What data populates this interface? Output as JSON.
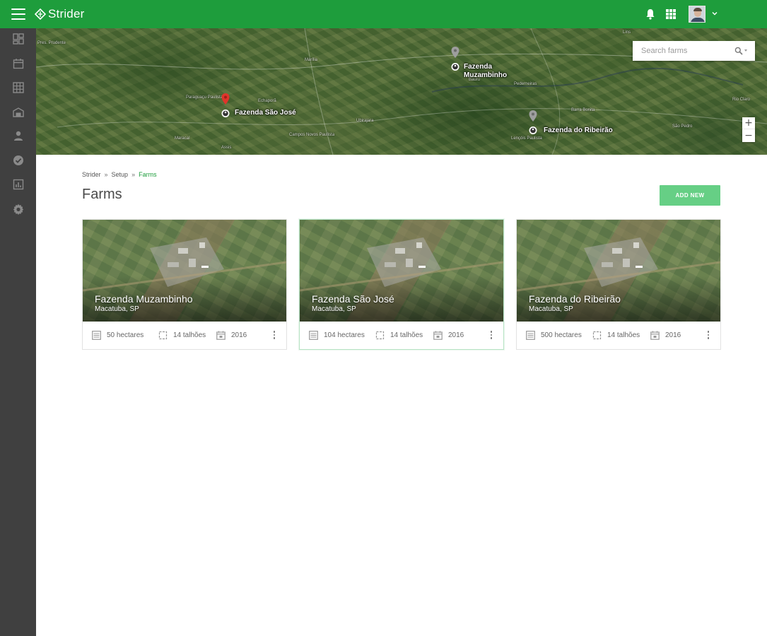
{
  "app": {
    "name": "Strider"
  },
  "header": {
    "icons": [
      "menu-icon",
      "notifications-icon",
      "apps-icon",
      "user-avatar",
      "chevron-down-icon"
    ]
  },
  "sidebar": {
    "items": [
      {
        "icon": "dashboard-icon"
      },
      {
        "icon": "calendar-icon"
      },
      {
        "icon": "grid-icon"
      },
      {
        "icon": "warehouse-icon"
      },
      {
        "icon": "person-icon"
      },
      {
        "icon": "check-circle-icon"
      },
      {
        "icon": "reports-icon"
      },
      {
        "icon": "settings-icon"
      }
    ]
  },
  "map": {
    "search_placeholder": "Search farms",
    "zoom_in": "+",
    "zoom_out": "−",
    "pins": [
      {
        "label": "Fazenda Muzambinho",
        "color": "#9e9e9e",
        "active": false
      },
      {
        "label": "Fazenda São José",
        "color": "#e0352b",
        "active": true
      },
      {
        "label": "Fazenda do Ribeirão",
        "color": "#9e9e9e",
        "active": false
      }
    ],
    "towns": [
      "Pres. Prudente",
      "Marília",
      "Bauru",
      "Lins",
      "Rio Claro",
      "Assis",
      "Lençóis Paulista",
      "Campos Novos Paulista",
      "Echaporã",
      "Ubirajara",
      "Pederneiras",
      "Barra Bonita",
      "São Pedro",
      "Maracaí",
      "Paraguaçu Paulista"
    ]
  },
  "breadcrumb": {
    "items": [
      "Strider",
      "Setup",
      "Farms"
    ],
    "separator": "»"
  },
  "page": {
    "title": "Farms",
    "add_button": "ADD NEW"
  },
  "farms": [
    {
      "name": "Fazenda Muzambinho",
      "location": "Macatuba, SP",
      "area": "50 hectares",
      "plots": "14 talhões",
      "year": "2016",
      "selected": false
    },
    {
      "name": "Fazenda São José",
      "location": "Macatuba, SP",
      "area": "104 hectares",
      "plots": "14 talhões",
      "year": "2016",
      "selected": true
    },
    {
      "name": "Fazenda do Ribeirão",
      "location": "Macatuba, SP",
      "area": "500 hectares",
      "plots": "14 talhões",
      "year": "2016",
      "selected": false
    }
  ],
  "colors": {
    "primary": "#1e9d3c",
    "sidebar": "#404040",
    "add_button": "#66cf85",
    "pin_active": "#e0352b",
    "pin_inactive": "#9e9e9e"
  }
}
